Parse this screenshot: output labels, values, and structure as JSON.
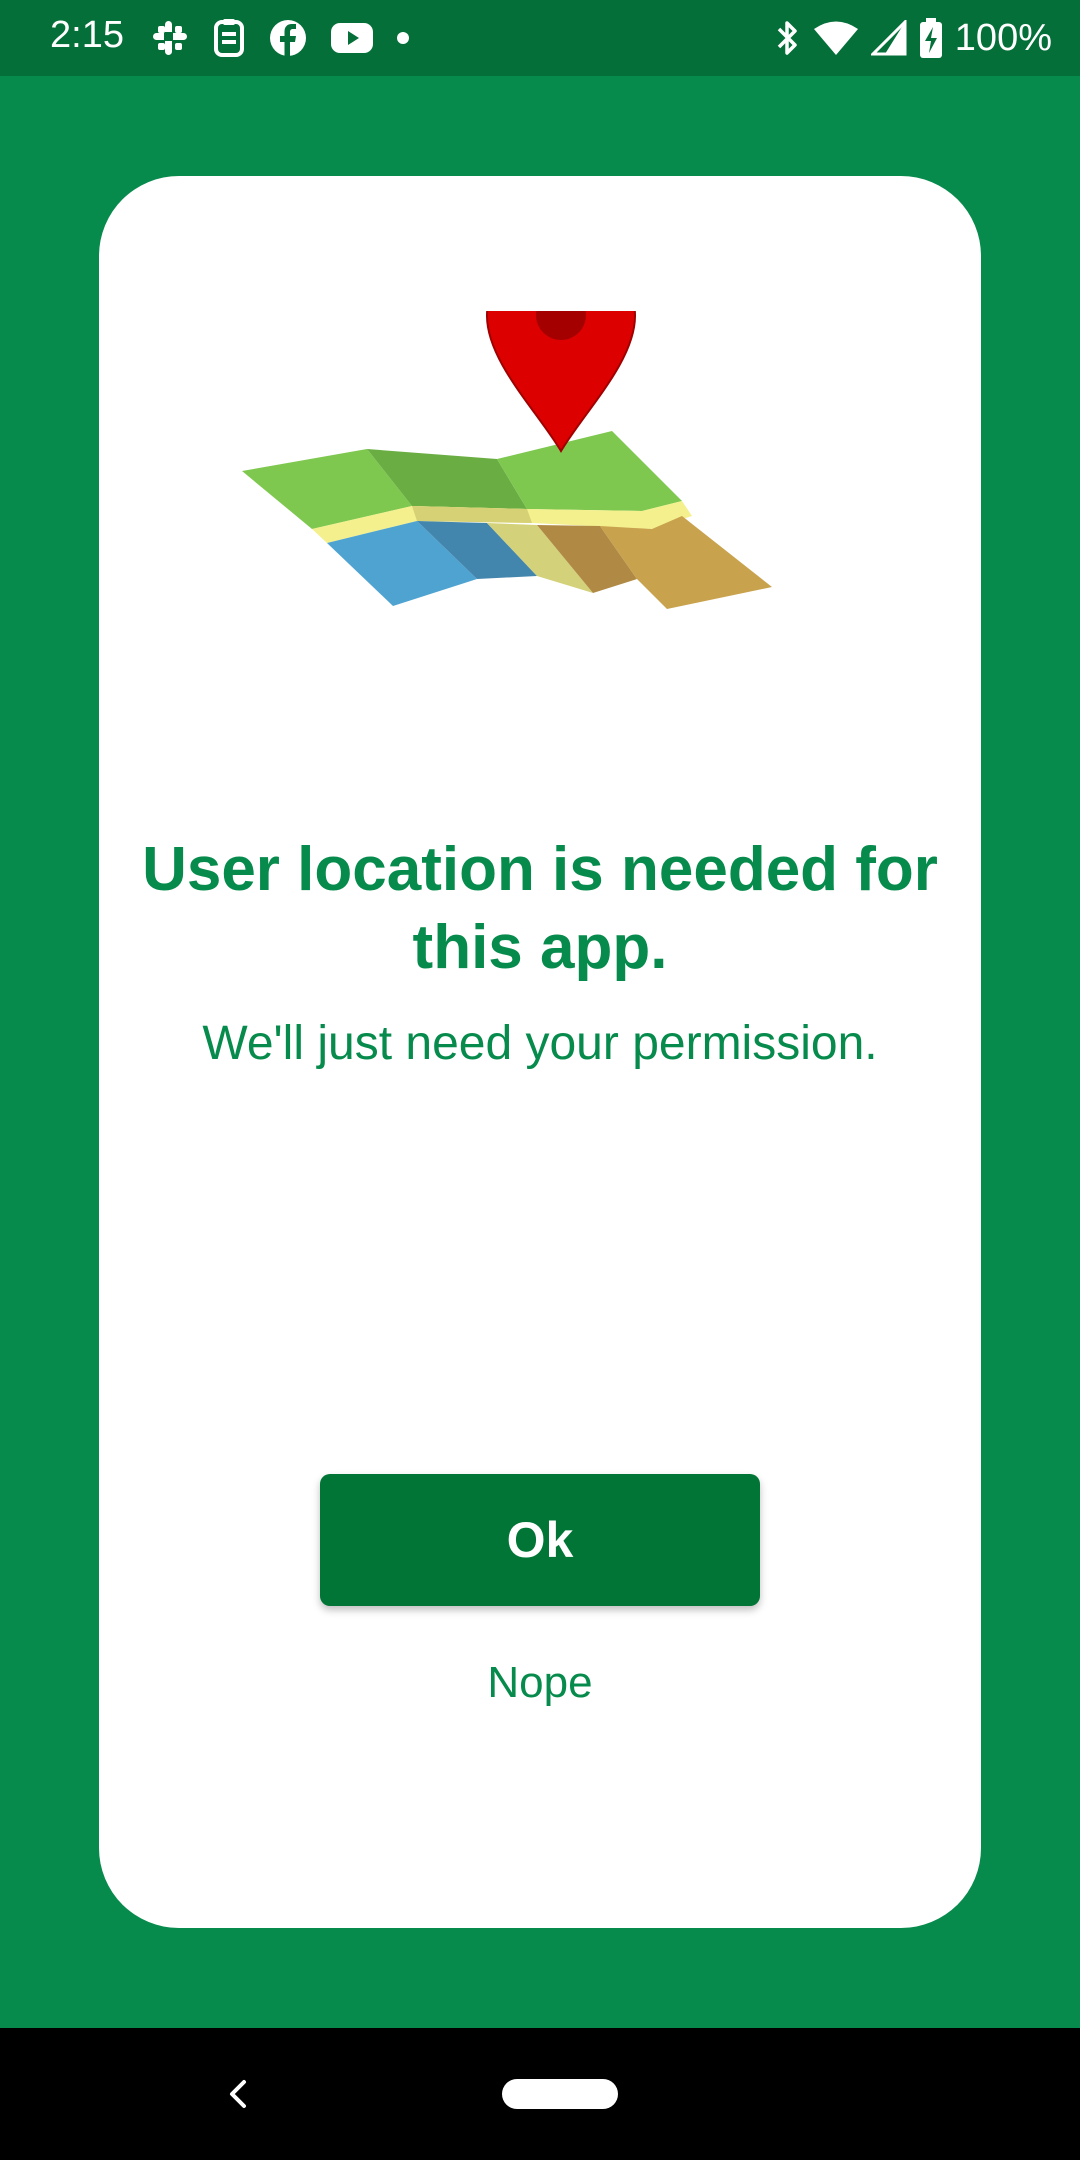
{
  "status_bar": {
    "time": "2:15",
    "battery_percent": "100%",
    "left_icons": [
      "slack-icon",
      "clipboard-icon",
      "facebook-icon",
      "youtube-icon",
      "more-notifications-dot-icon"
    ],
    "right_icons": [
      "bluetooth-icon",
      "wifi-icon",
      "cell-signal-icon",
      "battery-charging-icon"
    ],
    "colors": {
      "background": "#056f39",
      "foreground": "#ffffff"
    }
  },
  "dialog": {
    "illustration": "map-with-location-pin-icon",
    "title": "User location is needed for this app.",
    "subtitle": "We'll just need your permission.",
    "ok_label": "Ok",
    "nope_label": "Nope"
  },
  "nav_bar": {
    "icons": [
      "back-icon",
      "home-pill-icon"
    ]
  },
  "colors": {
    "app_background": "#078b4c",
    "card_background": "#ffffff",
    "accent_text": "#078b4c",
    "button_background": "#007535",
    "button_text": "#ffffff",
    "nav_background": "#000000"
  }
}
